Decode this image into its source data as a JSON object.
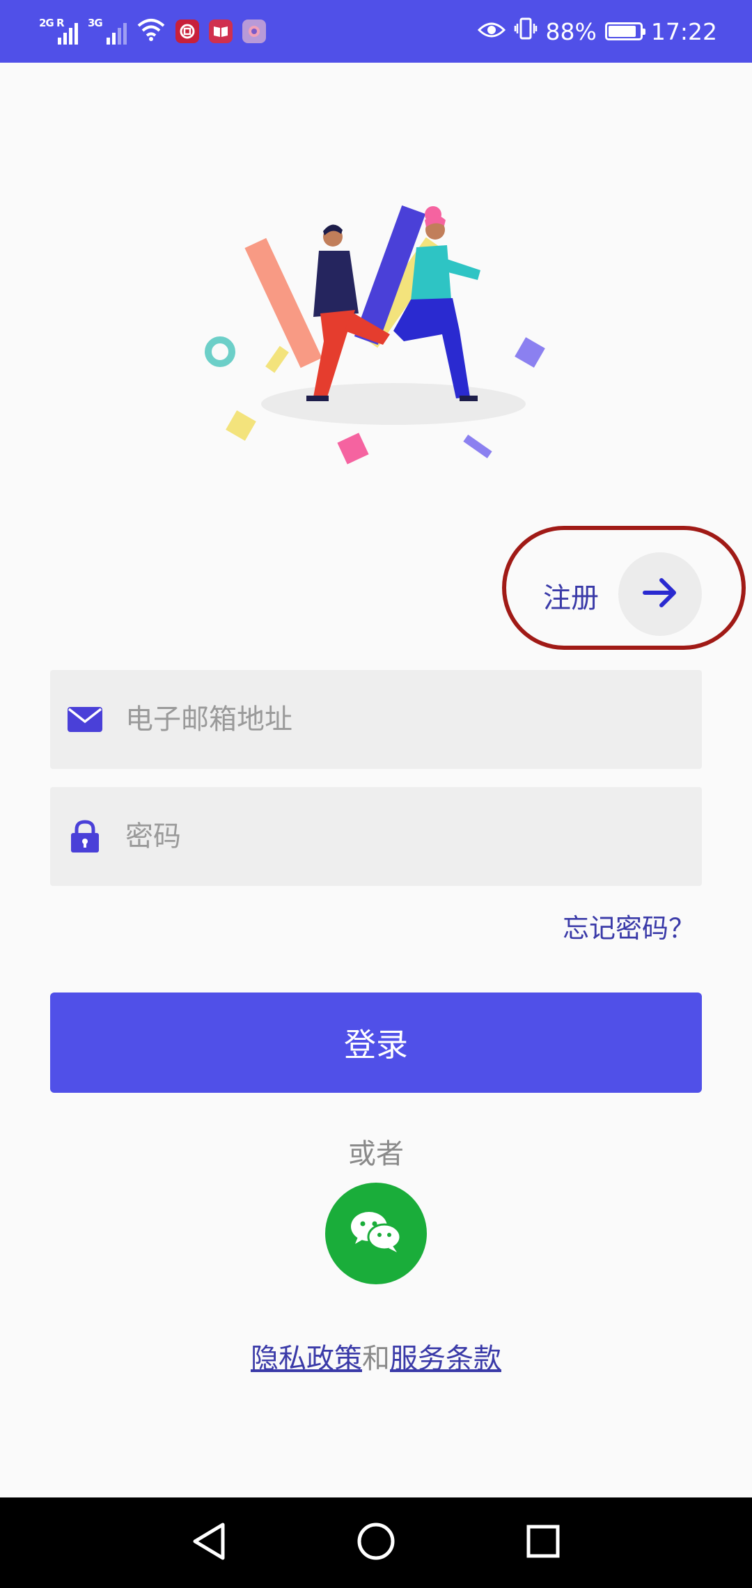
{
  "status_bar": {
    "signal1_label": "2G R",
    "signal2_label": "3G",
    "battery_percent": "88%",
    "time": "17:22",
    "colors": {
      "background": "#5050e8"
    },
    "icons": [
      "wifi-icon",
      "bank-app-icon",
      "reader-app-icon",
      "social-app-icon",
      "eye-comfort-icon",
      "vibrate-icon",
      "battery-icon"
    ]
  },
  "register": {
    "label": "注册",
    "icon": "arrow-right-icon"
  },
  "email_field": {
    "placeholder": "电子邮箱地址",
    "icon": "mail-icon",
    "value": ""
  },
  "password_field": {
    "placeholder": "密码",
    "icon": "lock-icon",
    "value": ""
  },
  "forgot_password": "忘记密码？",
  "login_button": "登录",
  "or_text": "或者",
  "wechat_login": {
    "icon": "wechat-icon",
    "color": "#1aad3a"
  },
  "legal": {
    "privacy": "隐私政策",
    "and": "和",
    "terms": "服务条款"
  },
  "nav_bar": {
    "buttons": [
      "back-icon",
      "home-icon",
      "recents-icon"
    ]
  },
  "colors": {
    "accent": "#5050e8",
    "link": "#3a3aa8",
    "highlight_ring": "#a01a16"
  }
}
